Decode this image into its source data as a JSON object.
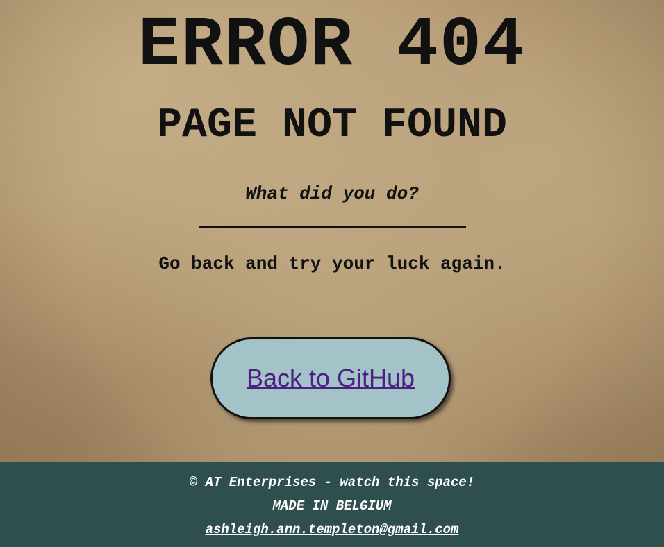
{
  "main": {
    "title": "ERROR 404",
    "subtitle": "PAGE NOT FOUND",
    "question": "What did you do?",
    "instruction": "Go back and try your luck again."
  },
  "button": {
    "label": "Back to GitHub"
  },
  "footer": {
    "copyright": "© AT Enterprises - watch this space!",
    "made_in": "MADE IN BELGIUM",
    "email": "ashleigh.ann.templeton@gmail.com"
  },
  "colors": {
    "background": "#b49a75",
    "footer_bg": "#2f4f4f",
    "button_bg": "#a3c3c8",
    "link": "#4b2082",
    "text": "#111111"
  }
}
